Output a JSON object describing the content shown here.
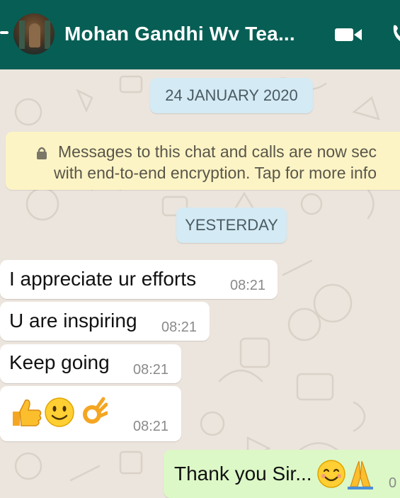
{
  "header": {
    "title": "Mohan Gandhi Wv Tea...",
    "icons": [
      "back-icon",
      "avatar",
      "video-call-icon",
      "call-icon"
    ]
  },
  "chat": {
    "date_chips": [
      "24 JANUARY 2020",
      "YESTERDAY"
    ],
    "encryption_notice": {
      "line1": "Messages to this chat and calls are now sec",
      "line2": "with end-to-end encryption. Tap for more info"
    },
    "messages": [
      {
        "direction": "incoming",
        "text": "I appreciate ur efforts",
        "time": "08:21"
      },
      {
        "direction": "incoming",
        "text": "U are inspiring",
        "time": "08:21"
      },
      {
        "direction": "incoming",
        "text": "Keep going",
        "time": "08:21"
      },
      {
        "direction": "incoming",
        "text": "",
        "emojis": [
          "thumbs-up",
          "smiling-face",
          "ok-hand"
        ],
        "time": "08:21"
      },
      {
        "direction": "outgoing",
        "text": "Thank you Sir...",
        "emojis": [
          "smiling-face-with-smiling-eyes",
          "folded-hands"
        ],
        "time": "0"
      }
    ]
  },
  "colors": {
    "header": "#075e54",
    "background": "#ece5dd",
    "incoming": "#ffffff",
    "outgoing": "#dcf8c6",
    "date_chip": "#d4eaf4",
    "notice": "#fdf4c5"
  }
}
